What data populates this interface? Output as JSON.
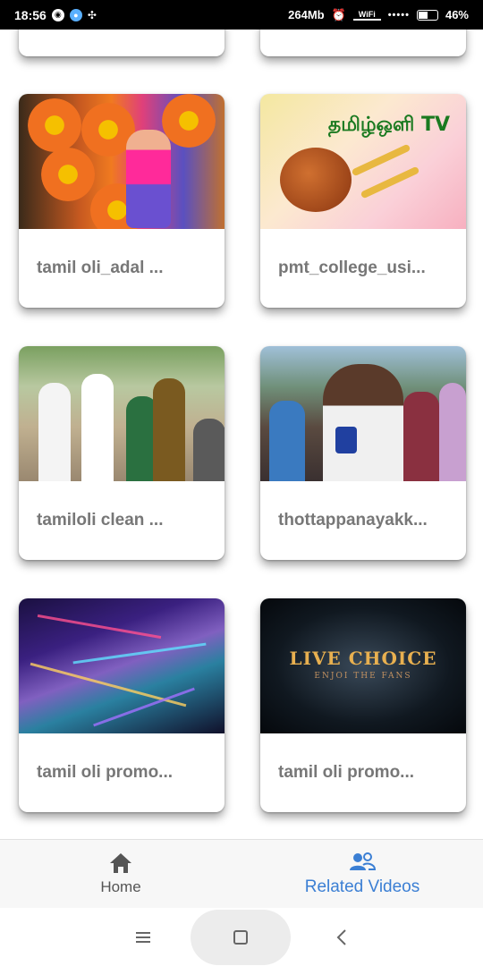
{
  "status_bar": {
    "time": "18:56",
    "memory": "264Mb",
    "wifi_label": "WiFi",
    "battery": "46%"
  },
  "videos": [
    {
      "title": "tamil oli_adal ..."
    },
    {
      "title": "pmt_college_usi..."
    },
    {
      "title": "tamiloli clean ..."
    },
    {
      "title": "thottappanayakk..."
    },
    {
      "title": "tamil oli promo..."
    },
    {
      "title": "tamil oli promo..."
    }
  ],
  "thumbnail_text": {
    "pongal_logo": "தமிழ்ஒளி TV",
    "live_choice": "LIVE CHOICE",
    "enjoy_fans": "ENJOI THE FANS"
  },
  "bottom_nav": {
    "home_label": "Home",
    "related_label": "Related Videos"
  },
  "colors": {
    "accent": "#3b7fd4",
    "title_text": "#777777"
  }
}
